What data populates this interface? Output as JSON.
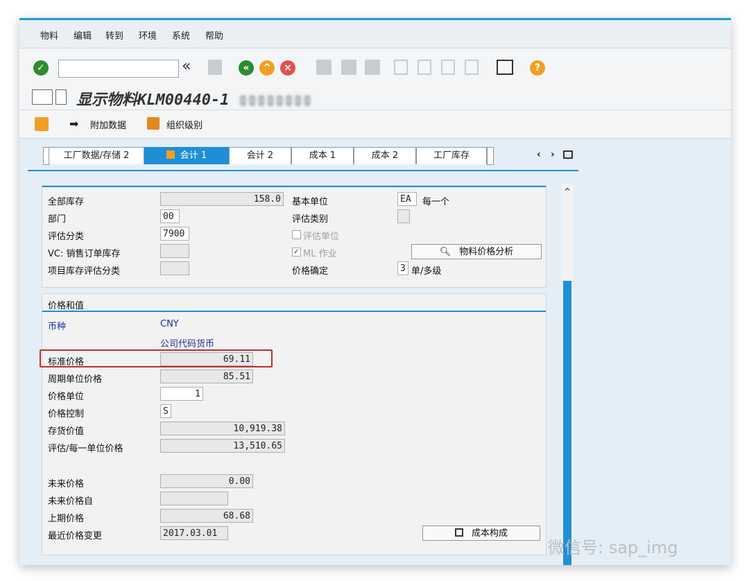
{
  "menu": [
    "物料",
    "编辑",
    "转到",
    "环境",
    "系统",
    "帮助"
  ],
  "toolbar": {
    "command_value": "",
    "back_glyph": "«"
  },
  "title": {
    "text": "显示物料KLM00440-1 ",
    "obscured": "▯▯▯▯▯▯▯▯"
  },
  "appbar": {
    "additional_data": "附加数据",
    "org_levels": "组织级别"
  },
  "tabs": [
    "工厂数据/存储 2",
    "会计 1",
    "会计 2",
    "成本 1",
    "成本 2",
    "工厂库存"
  ],
  "active_tab_index": 1,
  "general": {
    "total_stock_label": "全部库存",
    "total_stock": "158.0",
    "division_label": "部门",
    "division": "00",
    "valuation_class_label": "评估分类",
    "valuation_class": "7900",
    "vc_label": "VC: 销售订单库存",
    "vc": "",
    "proj_label": "项目库存评估分类",
    "proj": "",
    "base_unit_label": "基本单位",
    "base_unit": "EA",
    "base_unit_text": "每一个",
    "valuation_cat_label": "评估类别",
    "valuation_cat": "",
    "valuated_unit_label": "评估单位",
    "ml_label": "ML 作业",
    "price_det_label": "价格确定",
    "price_det": "3",
    "price_det_text": "单/多级",
    "analysis_button": "物料价格分析"
  },
  "prices": {
    "section_title": "价格和值",
    "currency_label": "币种",
    "currency": "CNY",
    "currency_note": "公司代码货币",
    "std_price_label": "标准价格",
    "std_price": "69.11",
    "periodic_price_label": "周期单位价格",
    "periodic_price": "85.51",
    "price_unit_label": "价格单位",
    "price_unit": "1",
    "price_control_label": "价格控制",
    "price_control": "S",
    "inventory_value_label": "存货价值",
    "inventory_value": "10,919.38",
    "valuated_unit_price_label": "评估/每一单位价格",
    "valuated_unit_price": "13,510.65",
    "future_price_label": "未来价格",
    "future_price": "0.00",
    "future_from_label": "未来价格自",
    "future_from": "",
    "prev_price_label": "上期价格",
    "prev_price": "68.68",
    "last_change_label": "最近价格变更",
    "last_change": "2017.03.01",
    "cost_comp_button": "成本构成"
  },
  "watermark": "微信号: sap_img",
  "colors": {
    "accent": "#1e8fd6",
    "highlight": "#c72b2b",
    "ok": "#2e8b2e",
    "warn": "#f0a020",
    "cancel": "#e05050"
  }
}
